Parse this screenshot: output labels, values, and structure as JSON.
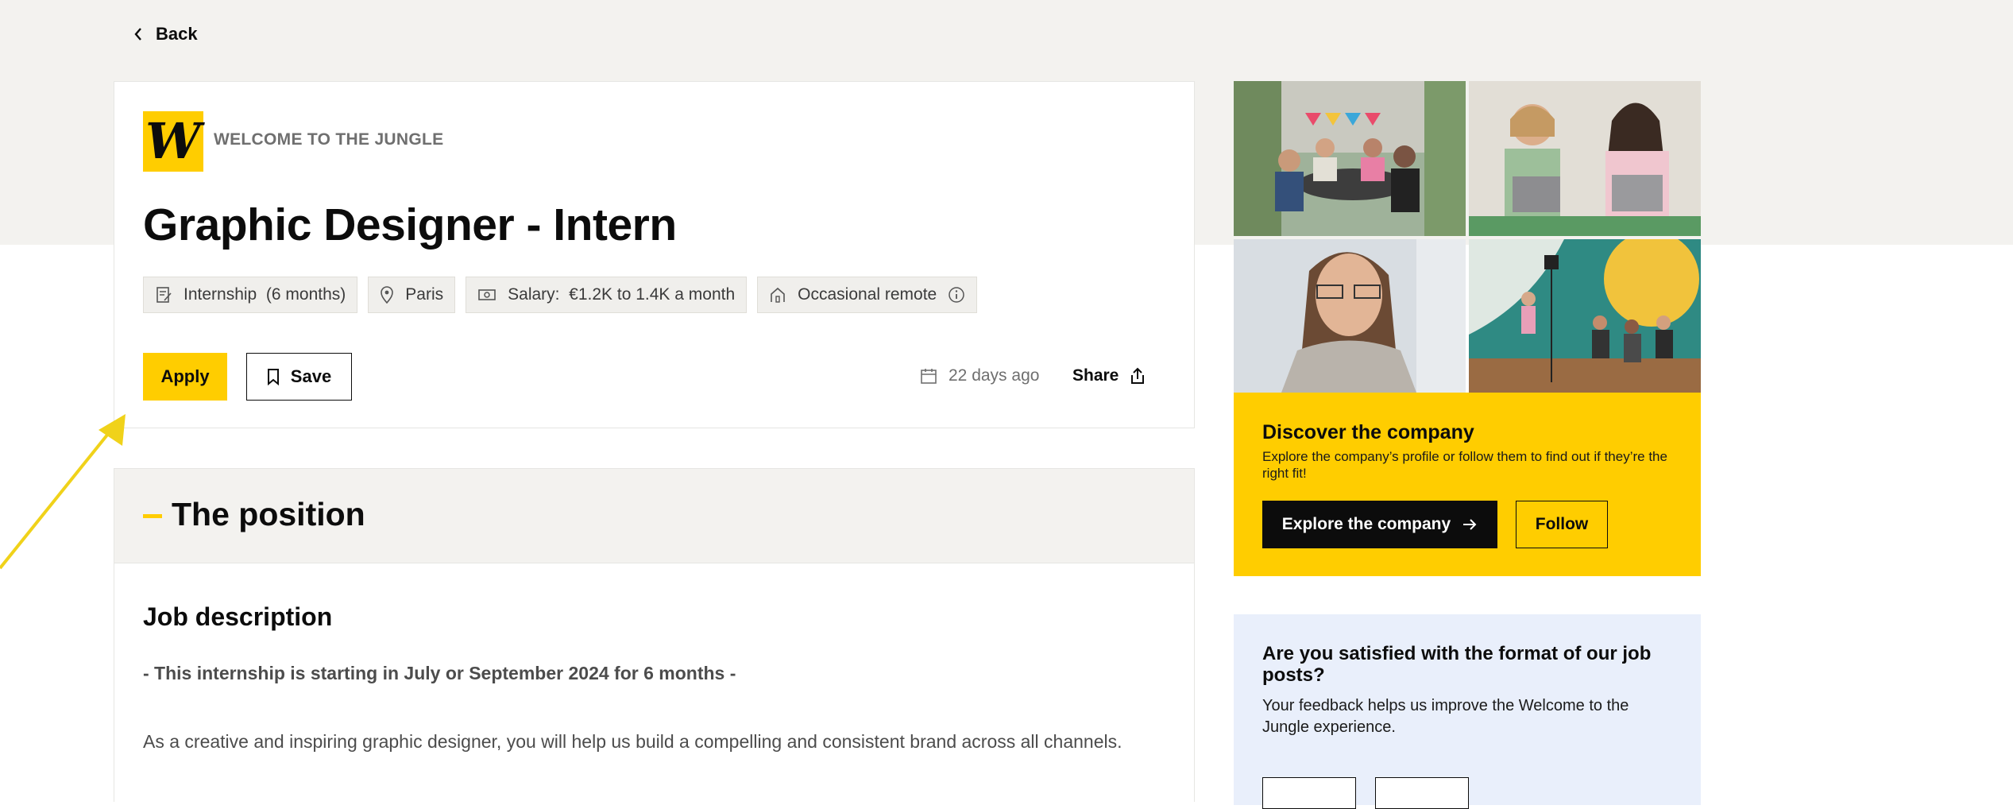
{
  "nav": {
    "back_label": "Back"
  },
  "company": {
    "name": "WELCOME TO THE JUNGLE",
    "logo_letter": "W"
  },
  "job": {
    "title": "Graphic Designer - Intern",
    "tags": [
      {
        "icon": "contract-icon",
        "label": "Internship",
        "detail": "(6 months)"
      },
      {
        "icon": "location-pin-icon",
        "label": "Paris"
      },
      {
        "icon": "banknote-icon",
        "label": "Salary:",
        "detail": "€1.2K to 1.4K a month"
      },
      {
        "icon": "remote-home-icon",
        "label": "Occasional remote",
        "has_info": true
      }
    ],
    "apply_label": "Apply",
    "save_label": "Save",
    "posted": "22 days ago",
    "share_label": "Share"
  },
  "position": {
    "heading": "The position",
    "job_description_heading": "Job description",
    "intro": "- This internship is starting in July or September 2024 for 6 months -",
    "paragraph": "As a creative and inspiring graphic designer, you will help us build a compelling and consistent brand across all channels."
  },
  "sidebar": {
    "discover": {
      "title": "Discover the company",
      "text": "Explore the company’s profile or follow them to find out if they’re the right fit!",
      "explore_label": "Explore the company",
      "follow_label": "Follow"
    },
    "feedback": {
      "title": "Are you satisfied with the format of our job posts?",
      "text": "Your feedback helps us improve the Welcome to the Jungle experience."
    }
  },
  "colors": {
    "brand_yellow": "#ffcd00",
    "band_grey": "#f3f2ef",
    "feedback_blue": "#e9effb"
  }
}
